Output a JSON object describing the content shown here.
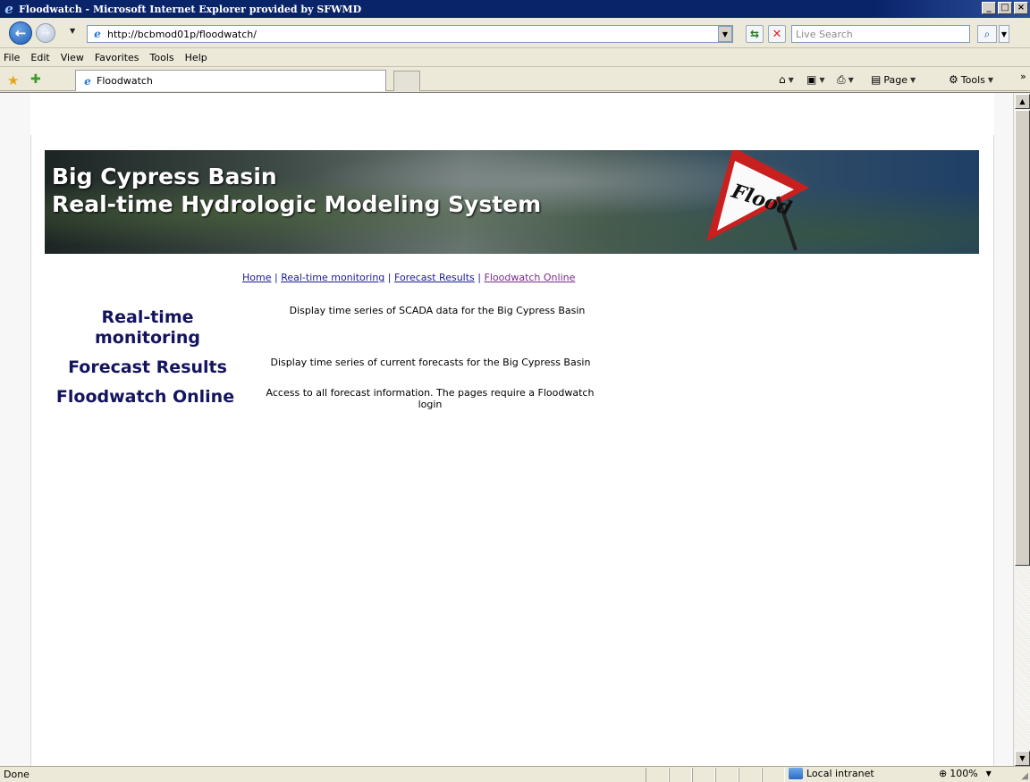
{
  "window": {
    "title": "Floodwatch - Microsoft Internet Explorer provided by SFWMD",
    "controls": {
      "minimize": "_",
      "maximize": "□",
      "close": "×"
    }
  },
  "address_bar": {
    "url": "http://bcbmod01p/floodwatch/",
    "search_placeholder": "Live Search"
  },
  "menu": {
    "items": [
      "File",
      "Edit",
      "View",
      "Favorites",
      "Tools",
      "Help"
    ]
  },
  "tabs": {
    "active_label": "Floodwatch"
  },
  "command_bar": {
    "page_label": "Page",
    "tools_label": "Tools"
  },
  "banner": {
    "line1": "Big Cypress Basin",
    "line2": "Real-time Hydrologic Modeling System",
    "sign_text": "Flood"
  },
  "nav": {
    "home": "Home",
    "monitoring": "Real-time monitoring",
    "forecast": "Forecast Results",
    "floodwatch": "Floodwatch Online",
    "separator": "|"
  },
  "sections": [
    {
      "title": "Real-time monitoring",
      "description": "Display time series of SCADA data for the Big Cypress Basin"
    },
    {
      "title": "Forecast Results",
      "description": "Display time series of current forecasts for the Big Cypress Basin"
    },
    {
      "title": "Floodwatch Online",
      "description": "Access to all forecast information. The pages require a Floodwatch login"
    }
  ],
  "status_bar": {
    "status": "Done",
    "zone": "Local intranet",
    "zoom": "100%"
  },
  "colors": {
    "titlebar": "#0a246a",
    "link": "#1b1b9a",
    "visited_link": "#7a2a8a",
    "heading": "#14145e"
  }
}
